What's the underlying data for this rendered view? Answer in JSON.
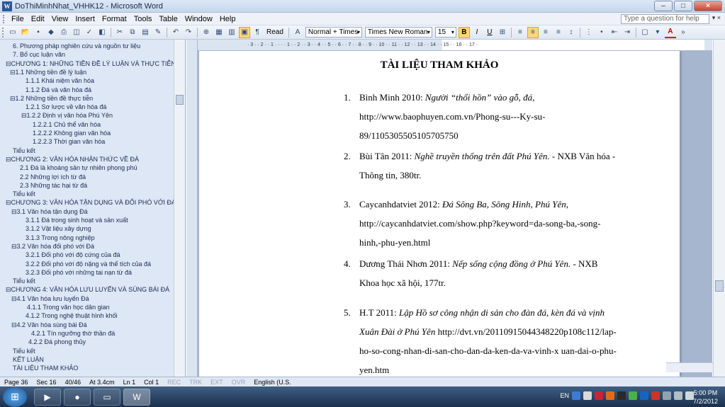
{
  "window": {
    "title": "DoThiMinhNhat_VHHK12 - Microsoft Word",
    "app_icon": "W",
    "controls": {
      "minimize": "–",
      "maximize": "□",
      "close": "×"
    }
  },
  "menubar": {
    "items": [
      "File",
      "Edit",
      "View",
      "Insert",
      "Format",
      "Tools",
      "Table",
      "Window",
      "Help"
    ],
    "ask_placeholder": "Type a question for help"
  },
  "toolbar": {
    "read_label": "Read",
    "style_value": "Normal + Times",
    "font_value": "Times New Roman",
    "size_value": "15",
    "bold": "B",
    "italic": "I",
    "underline": "U",
    "font_color": "A"
  },
  "nav": {
    "items": [
      "6. Phương pháp nghiên cứu và nguồn tư liệu",
      "7. Bố cục luận văn",
      "⊟CHƯƠNG 1: NHỮNG TIỀN ĐỀ LÝ LUẬN VÀ THỰC TIỄN",
      "⊟1.1  Những tiền đề lý luận",
      "1.1.1 Khái niệm văn hóa",
      "1.1.2 Đá và văn hóa đá",
      "⊟1.2  Những tiền đề thực tiễn",
      "1.2.1 Sơ lược về văn hóa đá",
      "⊟1.2.2  Định vị văn hóa Phú Yên",
      "1.2.2.1 Chủ thể văn hóa",
      "1.2.2.2  Không gian văn hóa",
      "1.2.2.3  Thời gian văn hóa",
      "Tiểu kết",
      "⊟CHƯƠNG 2: VĂN HÓA NHẬN THỨC VỀ ĐÁ",
      "2.1 Đá là khoáng sản tự nhiên phong phú",
      "2.2  Những lợi ích từ đá",
      "2.3 Những tác hại từ đá",
      "Tiểu kết",
      "⊟CHƯƠNG 3: VĂN HÓA TẬN DỤNG  VÀ ĐỐI PHÓ VỚI ĐÁ",
      "⊟3.1 Văn hóa tận dụng Đá",
      "3.1.1 Đá trong sinh hoạt và sản xuất",
      "3.1.2  Vật liệu xây dựng",
      "3.1.3 Trong nông nghiệp",
      "⊟3.2 Văn hóa đối phó với Đá",
      "3.2.1  Đối phó với độ cứng của đá",
      "3.2.2  Đối phó với độ nặng và thể tích của đá",
      "3.2.3 Đối phó với những tai nạn từ đá",
      "Tiểu kết",
      "⊟CHƯƠNG 4: VĂN HÓA LƯU LUYẾN VÀ SÙNG BÁI ĐÁ",
      "⊟4.1  Văn hóa lưu luyến Đá",
      "4.1.1 Trong văn học dân gian",
      "4.1.2  Trong nghệ thuật hình khối",
      "⊟4.2  Văn hóa sùng bái Đá",
      "4.2.1  Tín ngưỡng thờ thần đá",
      "4.2.2  Đá phong thủy",
      "Tiểu kết",
      "KẾT LUẬN",
      "TÀI LIỆU THAM KHẢO"
    ]
  },
  "ruler": {
    "ticks": "· 3 · · 2 · · 1 · · · · 1 · · 2 · · 3 · · 4 · · 5 · · 6 · · 7 · · 8 · · 9 · · 10 · · 11 · · 12 · · 13 · · 14 · · 15 · · 16 · · 17 ·"
  },
  "document": {
    "heading": "TÀI LIỆU THAM KHẢO",
    "references": [
      {
        "num": "1.",
        "lines": [
          [
            "Bình Minh 2010: ",
            "Người “thổi hồn” vào gỗ, đá,"
          ],
          [
            "http://www.baophuyen.com.vn/Phong-su---Ky-su-",
            ""
          ],
          [
            "89/1105305505105705750",
            ""
          ]
        ]
      },
      {
        "num": "2.",
        "lines": [
          [
            "Bùi Tân 2011: ",
            "Nghề truyền thống trên đất Phú Yên.",
            " - NXB Văn hóa -"
          ],
          [
            "Thông tin, 380tr.",
            ""
          ]
        ]
      },
      {
        "num": "3.",
        "lines": [
          [
            "Caycanhdatviet 2012: ",
            "Đá Sông Ba, Sông Hinh, Phú Yên,"
          ],
          [
            "http://caycanhdatviet.com/show.php?keyword=da-song-ba,-song-",
            ""
          ],
          [
            "hinh,-phu-yen.html",
            ""
          ]
        ]
      },
      {
        "num": "4.",
        "lines": [
          [
            "Dương Thái Nhơn 2011: ",
            "Nếp sống cộng đồng ở Phú Yên.",
            " - NXB"
          ],
          [
            "Khoa học xã hội, 177tr.",
            ""
          ]
        ]
      },
      {
        "num": "5.",
        "lines": [
          [
            "H.T 2011: ",
            "Lập Hồ sơ công nhận di sản cho đàn đá, kèn đá và vịnh"
          ],
          [
            "",
            "Xuân Đài ở Phú Yên",
            "  http://dvt.vn/20110915044348220p108c112/lap-"
          ],
          [
            "ho-so-cong-nhan-di-san-cho-dan-da-ken-da-va-vinh-x uan-dai-o-phu-",
            ""
          ],
          [
            "yen.htm",
            ""
          ]
        ]
      }
    ]
  },
  "status": {
    "page": "Page 36",
    "sec": "Sec 16",
    "pages": "40/46",
    "at": "At 3.4cm",
    "ln": "Ln 1",
    "col": "Col 1",
    "rec": "REC",
    "trk": "TRK",
    "ext": "EXT",
    "ovr": "OVR",
    "lang": "English (U.S."
  },
  "taskbar": {
    "lang": "EN",
    "time": "5:00 PM",
    "date": "7/2/2012"
  },
  "colors": {
    "accent": "#2b579a",
    "nav_bg": "#dde7f5",
    "page_bg": "#a7b6cf"
  }
}
